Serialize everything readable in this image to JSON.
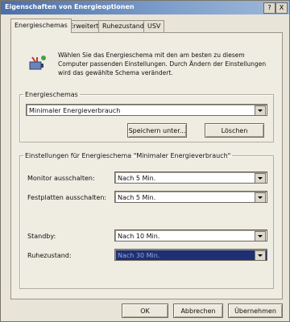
{
  "window": {
    "title": "Eigenschaften von Energieoptionen",
    "help_button": "?",
    "close_button": "X"
  },
  "tabs": [
    {
      "label": "Energieschemas",
      "active": true
    },
    {
      "label": "Erweitert",
      "active": false
    },
    {
      "label": "Ruhezustand",
      "active": false
    },
    {
      "label": "USV",
      "active": false
    }
  ],
  "info_text": "Wählen Sie das Energieschema mit den am besten zu diesem Computer passenden Einstellungen. Durch Ändern der Einstellungen wird das gewählte Schema verändert.",
  "schemes": {
    "legend": "Energieschemas",
    "selected": "Minimaler Energieverbrauch",
    "save_as_label": "Speichern unter...",
    "delete_label": "Löschen"
  },
  "settings": {
    "legend": "Einstellungen für Energieschema \"Minimaler Energieverbrauch\"",
    "monitor_label": "Monitor ausschalten:",
    "monitor_value": "Nach 5 Min.",
    "disks_label": "Festplatten ausschalten:",
    "disks_value": "Nach 5 Min.",
    "standby_label": "Standby:",
    "standby_value": "Nach 10 Min.",
    "hibernate_label": "Ruhezustand:",
    "hibernate_value": "Nach 30 Min."
  },
  "footer": {
    "ok_label": "OK",
    "cancel_label": "Abbrechen",
    "apply_label": "Übernehmen"
  }
}
